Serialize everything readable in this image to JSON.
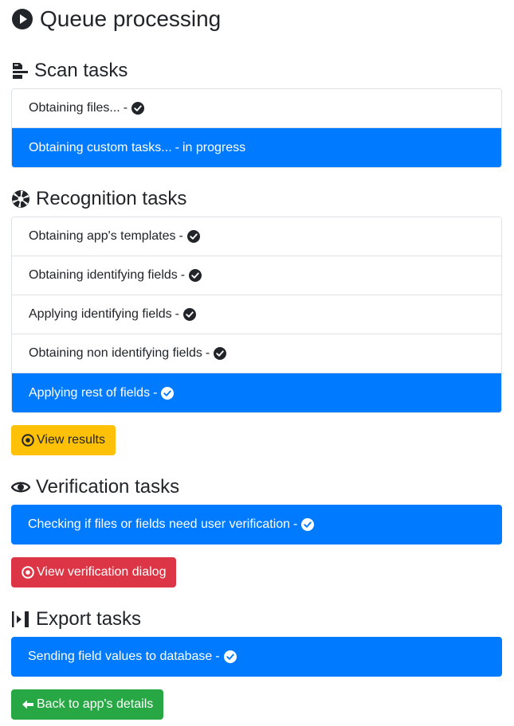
{
  "page": {
    "title": "Queue processing",
    "title_icon": "play-circle-icon"
  },
  "sections": {
    "scan": {
      "title": "Scan tasks",
      "icon": "scan-document-icon",
      "items": [
        {
          "label": "Obtaining files...",
          "sep": "-",
          "status": "",
          "done": true,
          "active": false
        },
        {
          "label": "Obtaining custom tasks...",
          "sep": "-",
          "status": "in progress",
          "done": false,
          "active": true
        }
      ]
    },
    "recognition": {
      "title": "Recognition tasks",
      "icon": "aperture-icon",
      "items": [
        {
          "label": "Obtaining app's templates",
          "sep": "-",
          "done": true,
          "active": false
        },
        {
          "label": "Obtaining identifying fields",
          "sep": "-",
          "done": true,
          "active": false
        },
        {
          "label": "Applying identifying fields",
          "sep": "-",
          "done": true,
          "active": false
        },
        {
          "label": "Obtaining non identifying fields",
          "sep": "-",
          "done": true,
          "active": false
        },
        {
          "label": "Applying rest of fields",
          "sep": "-",
          "done": true,
          "active": true
        }
      ],
      "button_label": "View results",
      "button_icon": "target-icon"
    },
    "verification": {
      "title": "Verification tasks",
      "icon": "eye-icon",
      "items": [
        {
          "label": "Checking if files or fields need user verification",
          "sep": "-",
          "done": true,
          "active": true
        }
      ],
      "button_label": "View verification dialog",
      "button_icon": "target-icon"
    },
    "export": {
      "title": "Export tasks",
      "icon": "export-step-icon",
      "items": [
        {
          "label": "Sending field values to database",
          "sep": "-",
          "done": true,
          "active": true
        }
      ]
    }
  },
  "footer": {
    "back_label": "Back to app's details",
    "back_icon": "arrow-left-icon"
  },
  "colors": {
    "active": "#007bff",
    "warning": "#ffc107",
    "danger": "#dc3545",
    "success": "#28a745"
  }
}
